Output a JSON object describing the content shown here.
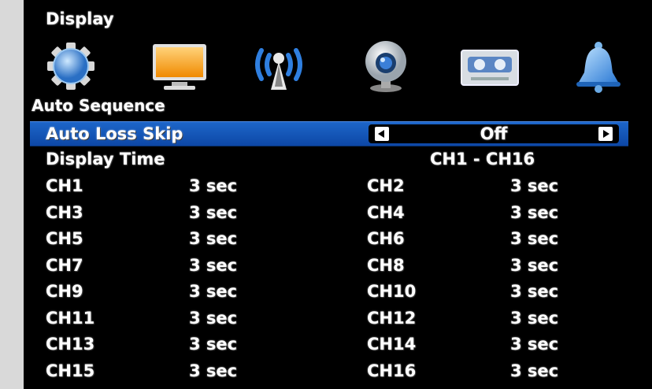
{
  "title": "Display",
  "icons": [
    "setup-gear-icon",
    "monitor-icon",
    "network-antenna-icon",
    "camera-icon",
    "recorder-tape-icon",
    "alarm-bell-icon"
  ],
  "section_title": "Auto Sequence",
  "auto_loss_skip": {
    "label": "Auto Loss Skip",
    "value": "Off"
  },
  "display_time": {
    "label": "Display Time",
    "range": "CH1 - CH16"
  },
  "channels": [
    {
      "ch": "CH1",
      "time": "3 sec"
    },
    {
      "ch": "CH2",
      "time": "3 sec"
    },
    {
      "ch": "CH3",
      "time": "3 sec"
    },
    {
      "ch": "CH4",
      "time": "3 sec"
    },
    {
      "ch": "CH5",
      "time": "3 sec"
    },
    {
      "ch": "CH6",
      "time": "3 sec"
    },
    {
      "ch": "CH7",
      "time": "3 sec"
    },
    {
      "ch": "CH8",
      "time": "3 sec"
    },
    {
      "ch": "CH9",
      "time": "3 sec"
    },
    {
      "ch": "CH10",
      "time": "3 sec"
    },
    {
      "ch": "CH11",
      "time": "3 sec"
    },
    {
      "ch": "CH12",
      "time": "3 sec"
    },
    {
      "ch": "CH13",
      "time": "3 sec"
    },
    {
      "ch": "CH14",
      "time": "3 sec"
    },
    {
      "ch": "CH15",
      "time": "3 sec"
    },
    {
      "ch": "CH16",
      "time": "3 sec"
    }
  ],
  "colors": {
    "highlight": "#1559b8",
    "background": "#000000",
    "text": "#ffffff"
  }
}
